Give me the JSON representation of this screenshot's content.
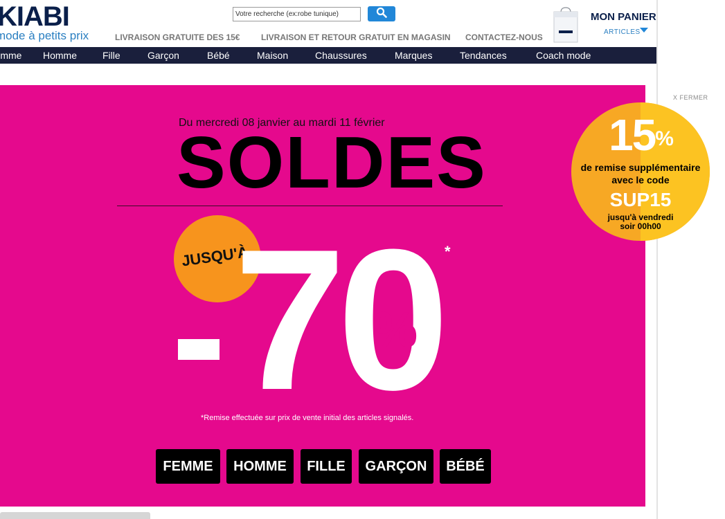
{
  "header": {
    "logo_text": "KIABI",
    "tagline": "la mode à petits prix",
    "search_placeholder": "Votre recherche (ex:robe tunique)",
    "links": [
      "LIVRAISON GRATUITE DES 15€",
      "LIVRAISON ET RETOUR GRATUIT EN MAGASIN",
      "CONTACTEZ-NOUS"
    ],
    "cart": {
      "title": "MON PANIER",
      "subtitle": "ARTICLES"
    }
  },
  "nav": {
    "items": [
      "Femme",
      "Homme",
      "Fille",
      "Garçon",
      "Bébé",
      "Maison",
      "Chaussures",
      "Marques",
      "Tendances",
      "Coach mode"
    ]
  },
  "close_label": "X FERMER",
  "banner": {
    "dates": "Du mercredi 08 janvier au mardi 11 février",
    "title": "SOLDES",
    "upto": "JUSQU'À",
    "discount": "70",
    "percent_sign": "%",
    "asterisk": "*",
    "note": "*Remise effectuée sur prix de vente initial des articles signalés.",
    "categories": [
      "FEMME",
      "HOMME",
      "FILLE",
      "GARÇON",
      "BÉBÉ"
    ]
  },
  "promo": {
    "value": "15",
    "percent_sign": "%",
    "line1": "de remise supplémentaire",
    "line2": "avec le code",
    "code": "SUP15",
    "line3": "jusqu'à vendredi soir 00h00"
  },
  "colors": {
    "brand_navy": "#0a1f4a",
    "brand_blue": "#2187d8",
    "banner_pink": "#e5098d",
    "orange": "#f7941d",
    "yellow": "#fcc322"
  }
}
